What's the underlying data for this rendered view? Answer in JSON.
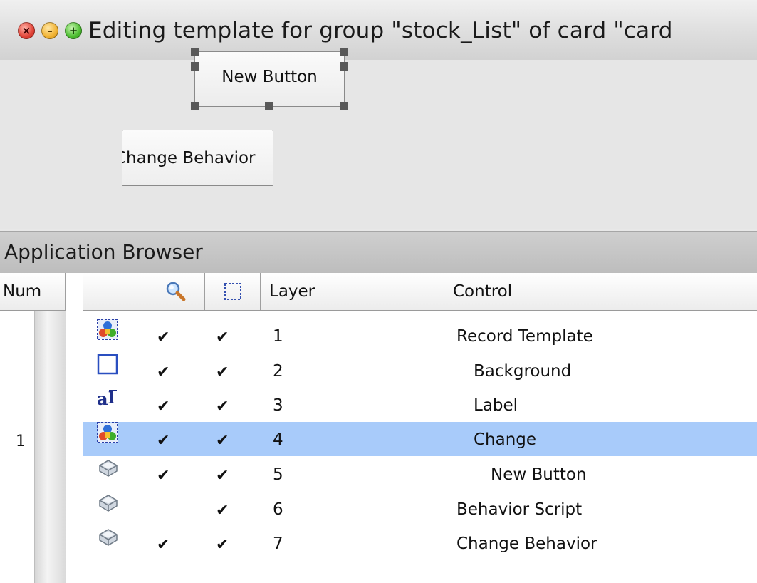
{
  "window": {
    "title": "Editing template for group \"stock_List\" of card \"card",
    "close_glyph": "×",
    "min_glyph": "–",
    "zoom_glyph": "+"
  },
  "canvas": {
    "new_button_label": "New Button",
    "change_behavior_label": "Change Behavior"
  },
  "browser": {
    "title": "Application Browser",
    "columns": {
      "num": "Num",
      "layer": "Layer",
      "control": "Control"
    },
    "num_value": "1",
    "rows": [
      {
        "icon": "group-icon",
        "visible": "✔",
        "selectable": "✔",
        "layer": "1",
        "control": "Record Template",
        "selected": false
      },
      {
        "icon": "graphic-rect-icon",
        "visible": "✔",
        "selectable": "✔",
        "layer": "2",
        "control": "Background",
        "selected": false
      },
      {
        "icon": "label-field-icon",
        "visible": "✔",
        "selectable": "✔",
        "layer": "3",
        "control": "Label",
        "selected": false
      },
      {
        "icon": "group-icon",
        "visible": "✔",
        "selectable": "✔",
        "layer": "4",
        "control": "Change",
        "selected": true
      },
      {
        "icon": "button-icon",
        "visible": "✔",
        "selectable": "✔",
        "layer": "5",
        "control": "New Button",
        "selected": false
      },
      {
        "icon": "button-icon",
        "visible": "",
        "selectable": "✔",
        "layer": "6",
        "control": "Behavior Script",
        "selected": false
      },
      {
        "icon": "button-icon",
        "visible": "✔",
        "selectable": "✔",
        "layer": "7",
        "control": "Change Behavior",
        "selected": false
      }
    ]
  },
  "colors": {
    "selection": "#a8cbfa",
    "icon_blue": "#2a3fa8"
  }
}
